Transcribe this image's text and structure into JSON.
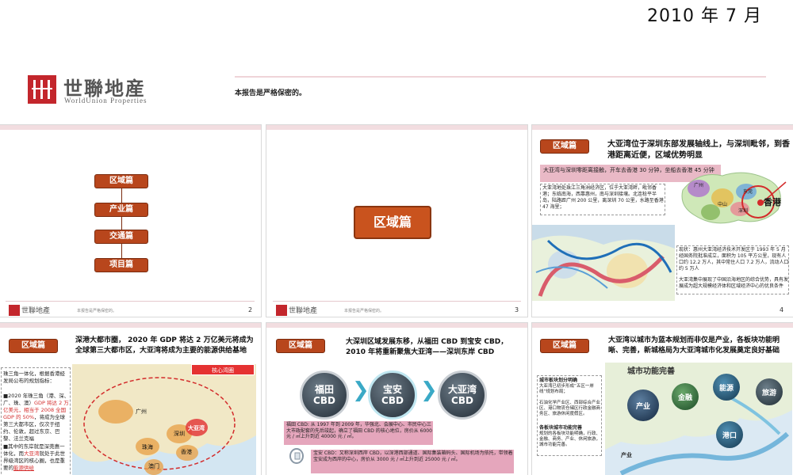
{
  "header": {
    "date": "2010 年 7 月",
    "company_cn": "世聯地産",
    "company_en": "WorldUnion Properties",
    "confidential": "本报告是严格保密的。"
  },
  "footer": {
    "company_cn": "世聯地產",
    "small_note": "本报告是严格保密的。"
  },
  "slide2": {
    "items": [
      "区域篇",
      "产业篇",
      "交通篇",
      "项目篇"
    ],
    "page": "2"
  },
  "slide3": {
    "title": "区域篇",
    "page": "3"
  },
  "slide4": {
    "tag": "区域篇",
    "heading": "大亚湾位于深圳东部发展轴线上，与深圳毗邻，到香港距离近便，区域优势明显",
    "highlight": "大亚湾与深圳零距离接触，开车去香港 30 分钟，坐船去香港 45 分钟",
    "para1": "大亚湾地处珠江三角洲经济区，位于大亚湾畔，毗邻香港；东临南海，西靠惠州，南与深圳接壤。北连稔平半岛，陆路距广州 200 公里，离深圳 70 公里，水路至香港 47 海里；",
    "para2": "现状：惠州大亚湾经济技术开发区于 1993 年 5 月经国务院批准成立，面积为 105 平方公里，现有人口约 12.2 万人，其中常住人口 7.2 万人，流动人口约 5 万人",
    "para3": "大亚湾集中展现了中国沿海地区的综合优势，具有发展成为超大规模经济体和区域经济中心的优良条件",
    "map_labels": [
      "广州",
      "中山",
      "东莞",
      "深圳"
    ],
    "hk_label": "香港",
    "page": "4"
  },
  "slide5": {
    "tag": "区域篇",
    "heading": "深港大都市圈， 2020 年 GDP 将达 2 万亿美元将成为全球第三大都市区，大亚湾将成为主要的能源供给基地",
    "text1": "珠三角一体化，根据香港经发局公布的规划指标：",
    "text2a": "■2020 年珠三角（港、深、广、珠、澳）",
    "text2b": "GDP 将达 2 万亿美元，相当于 2008 全国 GDP 的 50%",
    "text2c": "，将成为全球第三大都市区，仅次于纽约、伦敦，超过东京、巴黎、法兰克福",
    "text3a": "■其中的东岸就是深莞惠一体化，而",
    "text3b": "大亚湾",
    "text3c": "就处于此世界级湾区的核心圈，也是重要的",
    "text3d": "能源供给",
    "legend": "核心湾圈",
    "map_labels": [
      "广州",
      "深圳",
      "珠海",
      "香港",
      "澳门",
      "大亚湾"
    ]
  },
  "slide6": {
    "tag": "区域篇",
    "heading": "大深圳区域发展东移，从福田 CBD 到宝安 CBD， 2010 年将重新聚焦大亚湾——深圳东岸 CBD",
    "circles": [
      "福田\nCBD",
      "宝安\nCBD",
      "大亚湾\nCBD"
    ],
    "box1": "福田 CBD: 从 1997 年到 2009 年，华强北、会展中心、市民中心三大市政配套的先后竣起，确立了福田 CBD 的核心地位，房价从 6000 元 / ㎡上升到近 40000 元 / ㎡。",
    "box2": "宝安 CBD：又称深圳西岸 CBD，以深港西部通道、国际集装箱码头、国际机场为依托，带领着宝安成为西岸的中心，房价从 3000 元 / ㎡上升到近 25000 元 / ㎡。"
  },
  "slide7": {
    "tag": "区域篇",
    "heading": "大亚湾以城市为蓝本规划而非仅是产业，各板块功能明晰、完善，新城格局为大亚湾城市化发展奠定良好基础",
    "list_title": "城市板块划分明确",
    "list": [
      "大亚湾已初步形成“五区一岸线”规划布局；",
      "石油化学产业区、西部综合产业区、港口物流仓储区行政金融商务区、旅游休闲度假区。"
    ],
    "list_title2": "各板块城市功能完善",
    "list2": "规划的各板块功能明确，行政、金融、商务、产业、休闲旅游，城市功能完善。",
    "map_title": "城市功能完善",
    "balls": [
      "产业",
      "金融",
      "能源",
      "旅游",
      "港口"
    ],
    "industry_label": "产业"
  },
  "colors": {
    "brand_red": "#c3262c",
    "tag_orange": "#b8461c",
    "cyan_arrow": "#3aa9c6"
  }
}
